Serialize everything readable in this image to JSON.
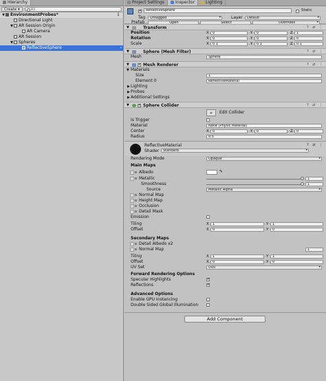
{
  "hierarchy": {
    "tab_label": "Hierarchy",
    "create_label": "Create",
    "search_placeholder": "All",
    "scene_name": "EnvironmentProbes*",
    "items": [
      {
        "label": "Directional Light"
      },
      {
        "label": "AR Session Origin"
      },
      {
        "label": "AR Camera"
      },
      {
        "label": "AR Session"
      },
      {
        "label": "Spheres"
      },
      {
        "label": "ReflectiveSphere"
      }
    ],
    "menu_glyph": "⋮"
  },
  "inspector": {
    "tabs": [
      {
        "label": "Project Settings"
      },
      {
        "label": "Inspector"
      },
      {
        "label": "Lighting"
      }
    ],
    "object": {
      "name": "ReflectiveSphere",
      "static_label": "Static",
      "tag_label": "Tag",
      "tag_value": "Untagged",
      "layer_label": "Layer",
      "layer_value": "Default",
      "prefab_label": "Prefab",
      "open_label": "Open",
      "select_label": "Select",
      "overrides_label": "Overrides"
    },
    "transform": {
      "title": "Transform",
      "position_label": "Position",
      "rotation_label": "Rotation",
      "scale_label": "Scale",
      "position": [
        "0",
        "0",
        "1"
      ],
      "rotation": [
        "0",
        "0",
        "0"
      ],
      "scale": [
        "0.1",
        "0.1",
        "0.1"
      ],
      "axes": [
        "X",
        "Y",
        "Z"
      ]
    },
    "mesh_filter": {
      "title": "Sphere (Mesh Filter)",
      "mesh_label": "Mesh",
      "mesh_value": "Sphere"
    },
    "mesh_renderer": {
      "title": "Mesh Renderer",
      "materials_label": "Materials",
      "size_label": "Size",
      "size_value": "1",
      "element_label": "Element 0",
      "element_value": "ReflectiveMaterial",
      "lighting_label": "Lighting",
      "probes_label": "Probes",
      "additional_label": "Additional Settings"
    },
    "sphere_collider": {
      "title": "Sphere Collider",
      "edit_label": "Edit Collider",
      "trigger_label": "Is Trigger",
      "material_label": "Material",
      "material_value": "None (Physic Material)",
      "center_label": "Center",
      "center": [
        "0",
        "0",
        "0"
      ],
      "radius_label": "Radius",
      "radius_value": "0.5"
    },
    "material": {
      "name": "ReflectiveMaterial",
      "shader_label": "Shader",
      "shader_value": "Standard",
      "rendering_mode_label": "Rendering Mode",
      "rendering_mode_value": "Opaque",
      "main_maps_label": "Main Maps",
      "albedo_label": "Albedo",
      "metallic_label": "Metallic",
      "metallic_value": "1",
      "smoothness_label": "Smoothness",
      "smoothness_value": "1",
      "source_label": "Source",
      "source_value": "Metallic Alpha",
      "normal_label": "Normal Map",
      "height_label": "Height Map",
      "occlusion_label": "Occlusion",
      "detail_mask_label": "Detail Mask",
      "emission_label": "Emission",
      "tiling_label": "Tiling",
      "offset_label": "Offset",
      "tiling": [
        "1",
        "1"
      ],
      "offset": [
        "0",
        "0"
      ],
      "secondary_label": "Secondary Maps",
      "detail_albedo_label": "Detail Albedo x2",
      "secondary_normal_label": "Normal Map",
      "secondary_normal_value": "1",
      "tiling2": [
        "1",
        "1"
      ],
      "offset2": [
        "0",
        "0"
      ],
      "uvset_label": "UV Set",
      "uvset_value": "UV0",
      "forward_label": "Forward Rendering Options",
      "specular_label": "Specular Highlights",
      "reflections_label": "Reflections",
      "advanced_label": "Advanced Options",
      "gpu_label": "Enable GPU Instancing",
      "double_label": "Double Sided Global Illumination"
    },
    "add_component_label": "Add Component",
    "colors": {
      "selection": "#3a72d8",
      "panel": "#c2c2c2"
    }
  }
}
